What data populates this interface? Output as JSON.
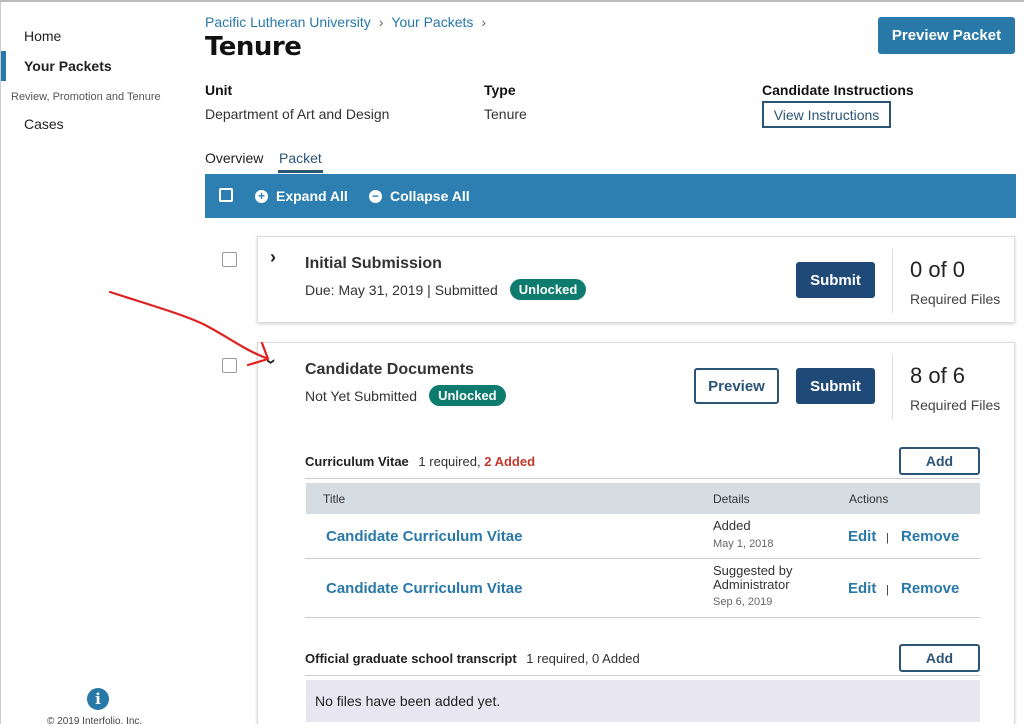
{
  "sidebar": {
    "home": "Home",
    "your_packets": "Your Packets",
    "section_heading": "Review, Promotion and Tenure",
    "cases": "Cases",
    "copyright": "© 2019 Interfolio, Inc."
  },
  "header": {
    "breadcrumb": [
      "Pacific Lutheran University",
      "Your Packets"
    ],
    "title": "Tenure",
    "preview_packet": "Preview Packet"
  },
  "meta": {
    "unit_label": "Unit",
    "unit_value": "Department of Art and Design",
    "type_label": "Type",
    "type_value": "Tenure",
    "instructions_label": "Candidate Instructions",
    "view_instructions": "View Instructions"
  },
  "tabs": [
    {
      "label": "Overview",
      "active": false
    },
    {
      "label": "Packet",
      "active": true
    }
  ],
  "toolbar": {
    "expand_all": "Expand All",
    "collapse_all": "Collapse All"
  },
  "sections": [
    {
      "title": "Initial Submission",
      "status_text": "Due: May 31, 2019 |  Submitted",
      "badge": "Unlocked",
      "submit": "Submit",
      "count": "0 of 0",
      "count_label": "Required Files",
      "expanded": false
    },
    {
      "title": "Candidate Documents",
      "status_text": "Not Yet Submitted",
      "badge": "Unlocked",
      "preview": "Preview",
      "submit": "Submit",
      "count": "8 of 6",
      "count_label": "Required Files",
      "expanded": true,
      "subsections": [
        {
          "title": "Curriculum Vitae",
          "required": "1 required,",
          "added": "2 Added",
          "add_label": "Add",
          "columns": [
            "Title",
            "Details",
            "Actions"
          ],
          "rows": [
            {
              "title": "Candidate Curriculum Vitae",
              "detail": "Added",
              "date": "May 1, 2018",
              "edit": "Edit",
              "remove": "Remove"
            },
            {
              "title": "Candidate Curriculum Vitae",
              "detail_line1": "Suggested by",
              "detail_line2": "Administrator",
              "date": "Sep 6, 2019",
              "edit": "Edit",
              "remove": "Remove"
            }
          ]
        },
        {
          "title": "Official graduate school transcript",
          "required": "1 required, 0 Added",
          "add_label": "Add",
          "empty_message": "No files have been added yet."
        }
      ]
    }
  ],
  "colors": {
    "primary": "#2878a8",
    "navy": "#1f4a78",
    "badge_teal": "#0d7c6e",
    "added_red": "#c0392b",
    "annotation_red": "#e02020"
  },
  "icons": [
    "info-icon",
    "plus-circle-icon",
    "minus-circle-icon",
    "chevron-right-icon",
    "chevron-down-icon"
  ]
}
